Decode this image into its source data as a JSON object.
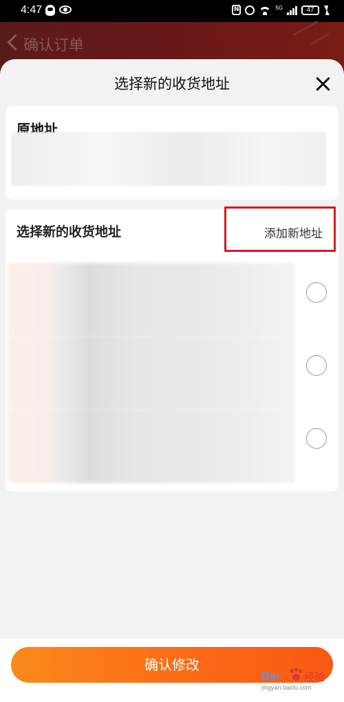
{
  "status_bar": {
    "time": "4:47",
    "network": "5G",
    "battery": "47"
  },
  "background_page": {
    "title": "确认订单"
  },
  "sheet": {
    "title": "选择新的收货地址",
    "original_address": {
      "label": "原地址"
    },
    "select_section": {
      "heading": "选择新的收货地址",
      "add_link": "添加新地址"
    },
    "options_count": 3
  },
  "confirm_button": {
    "label": "确认修改"
  },
  "watermark": {
    "brand": "Bai",
    "suffix": "经验",
    "url": "jingyan.baidu.com"
  },
  "colors": {
    "accent_start": "#fb8a1c",
    "accent_end": "#fb5814",
    "highlight_box": "#d9191f"
  }
}
